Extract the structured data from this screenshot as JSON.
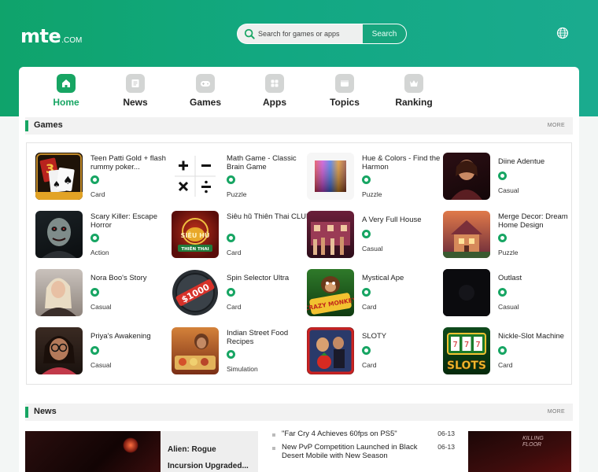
{
  "header": {
    "logo_main": "mte",
    "logo_suffix": ".COM",
    "search_placeholder": "Search for games or apps",
    "search_button": "Search",
    "globe_icon": "globe-icon"
  },
  "nav": [
    {
      "label": "Home",
      "icon": "home-icon",
      "active": true
    },
    {
      "label": "News",
      "icon": "news-icon",
      "active": false
    },
    {
      "label": "Games",
      "icon": "gamepad-icon",
      "active": false
    },
    {
      "label": "Apps",
      "icon": "apps-icon",
      "active": false
    },
    {
      "label": "Topics",
      "icon": "topics-icon",
      "active": false
    },
    {
      "label": "Ranking",
      "icon": "crown-icon",
      "active": false
    }
  ],
  "games_section": {
    "title": "Games",
    "more": "MORE",
    "items": [
      {
        "name": "Teen Patti Gold + flash rummy poker...",
        "category": "Card",
        "thumb": "cards-thumb"
      },
      {
        "name": "Math Game - Classic Brain Game",
        "category": "Puzzle",
        "thumb": "math-thumb"
      },
      {
        "name": "Hue & Colors - Find the Harmon",
        "category": "Puzzle",
        "thumb": "colors-thumb"
      },
      {
        "name": "Diine Adentue",
        "category": "Casual",
        "thumb": "portrait-thumb"
      },
      {
        "name": "Scary Killer: Escape Horror",
        "category": "Action",
        "thumb": "killer-thumb"
      },
      {
        "name": "Siêu hũ Thiên Thai CLUB",
        "category": "Card",
        "thumb": "sieuhu-thumb"
      },
      {
        "name": "A Very Full House",
        "category": "Casual",
        "thumb": "house-thumb"
      },
      {
        "name": "Merge Decor: Dream Home Design",
        "category": "Puzzle",
        "thumb": "decor-thumb"
      },
      {
        "name": "Nora Boo's Story",
        "category": "Casual",
        "thumb": "nora-thumb"
      },
      {
        "name": "Spin Selector Ultra",
        "category": "Card",
        "thumb": "spin-thumb"
      },
      {
        "name": "Mystical Ape",
        "category": "Card",
        "thumb": "ape-thumb"
      },
      {
        "name": "Outlast",
        "category": "Casual",
        "thumb": "outlast-thumb"
      },
      {
        "name": "Priya's Awakening",
        "category": "Casual",
        "thumb": "priya-thumb"
      },
      {
        "name": "Indian Street Food Recipes",
        "category": "Simulation",
        "thumb": "food-thumb"
      },
      {
        "name": "SLOTY",
        "category": "Card",
        "thumb": "sloty-thumb"
      },
      {
        "name": "Nickle-Slot Machine",
        "category": "Card",
        "thumb": "slots-thumb"
      }
    ],
    "thumb_text": {
      "spin": "$1000",
      "sieuhu": "SIÊU HŨ",
      "sieuhu_sub": "THIÊN THAI",
      "ape": "CRAZY MONKEY",
      "slots": "SLOTS"
    }
  },
  "news_section": {
    "title": "News",
    "more": "MORE",
    "feature_title": "Alien: Rogue Incursion Upgraded...",
    "items": [
      {
        "text": "\"Far Cry 4 Achieves 60fps on PS5\"",
        "date": "06-13"
      },
      {
        "text": "New PvP Competition Launched in Black Desert Mobile with New Season",
        "date": "06-13"
      }
    ],
    "side_text": "KILLING FLOOR"
  }
}
